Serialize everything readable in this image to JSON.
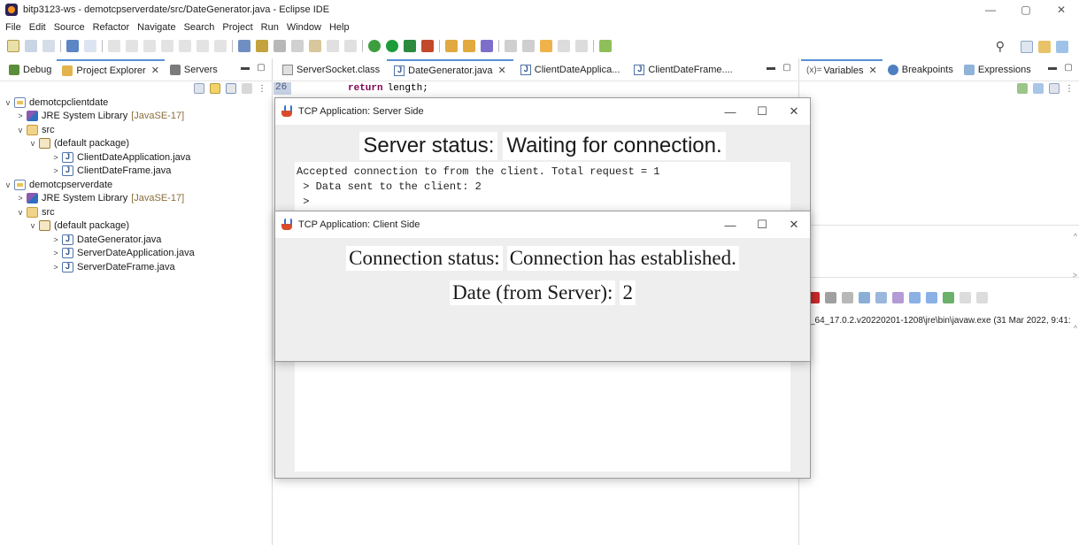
{
  "window": {
    "title": "bitp3123-ws - demotcpserverdate/src/DateGenerator.java - Eclipse IDE",
    "controls": [
      "—",
      "▢",
      "✕"
    ]
  },
  "menu": [
    "File",
    "Edit",
    "Source",
    "Refactor",
    "Navigate",
    "Search",
    "Project",
    "Run",
    "Window",
    "Help"
  ],
  "left_tabs": [
    {
      "label": "Debug",
      "icon": "debug-icon",
      "active": false
    },
    {
      "label": "Project Explorer",
      "icon": "project-explorer-icon",
      "active": true
    },
    {
      "label": "Servers",
      "icon": "servers-icon",
      "active": false
    }
  ],
  "tree": [
    {
      "label": "demotcpclientdate",
      "level": 0,
      "arrow": "v",
      "icon": "project-folder-icon"
    },
    {
      "label": "JRE System Library",
      "suffix": "[JavaSE-17]",
      "level": 1,
      "arrow": ">",
      "icon": "library-icon"
    },
    {
      "label": "src",
      "level": 1,
      "arrow": "v",
      "icon": "source-folder-icon"
    },
    {
      "label": "(default package)",
      "level": 2,
      "arrow": "v",
      "icon": "package-icon"
    },
    {
      "label": "ClientDateApplication.java",
      "level": 3,
      "arrow": ">",
      "icon": "java-file-icon"
    },
    {
      "label": "ClientDateFrame.java",
      "level": 3,
      "arrow": ">",
      "icon": "java-file-icon"
    },
    {
      "label": "demotcpserverdate",
      "level": 0,
      "arrow": "v",
      "icon": "project-folder-icon"
    },
    {
      "label": "JRE System Library",
      "suffix": "[JavaSE-17]",
      "level": 1,
      "arrow": ">",
      "icon": "library-icon"
    },
    {
      "label": "src",
      "level": 1,
      "arrow": "v",
      "icon": "source-folder-icon"
    },
    {
      "label": "(default package)",
      "level": 2,
      "arrow": "v",
      "icon": "package-icon"
    },
    {
      "label": "DateGenerator.java",
      "level": 3,
      "arrow": ">",
      "icon": "java-file-icon"
    },
    {
      "label": "ServerDateApplication.java",
      "level": 3,
      "arrow": ">",
      "icon": "java-file-icon"
    },
    {
      "label": "ServerDateFrame.java",
      "level": 3,
      "arrow": ">",
      "icon": "java-file-icon"
    }
  ],
  "editor_tabs": [
    {
      "label": "ServerSocket.class",
      "active": false,
      "closable": false
    },
    {
      "label": "DateGenerator.java",
      "active": true,
      "closable": true
    },
    {
      "label": "ClientDateApplica...",
      "active": false,
      "closable": false
    },
    {
      "label": "ClientDateFrame....",
      "active": false,
      "closable": false
    }
  ],
  "code": {
    "line_number": "26",
    "keyword": "return",
    "rest": "length;"
  },
  "right_tabs": [
    {
      "label": "Variables",
      "prefix": "(x)=",
      "active": true,
      "closable": true
    },
    {
      "label": "Breakpoints",
      "active": false,
      "closable": false
    },
    {
      "label": "Expressions",
      "active": false,
      "closable": false
    }
  ],
  "console": {
    "path": "_64_17.0.2.v20220201-1208\\jre\\bin\\javaw.exe  (31 Mar 2022, 9:41:"
  },
  "server_window": {
    "title": "TCP Application: Server Side",
    "status_label": "Server status:",
    "status_value": "Waiting for connection.",
    "log_lines": [
      "Accepted connection to from the client. Total request = 1",
      " > Data sent to the client: 2",
      " >"
    ]
  },
  "client_window": {
    "title": "TCP Application: Client Side",
    "connection_label": "Connection status:",
    "connection_value": "Connection has established.",
    "date_label": "Date (from Server):",
    "date_value": "2"
  },
  "win_glyphs": {
    "minimize": "—",
    "maximize": "☐",
    "close": "✕"
  },
  "colors": {
    "active_tab_accent": "#5a8fd6",
    "keyword": "#7f0055",
    "window_bg": "#eeeeee"
  }
}
